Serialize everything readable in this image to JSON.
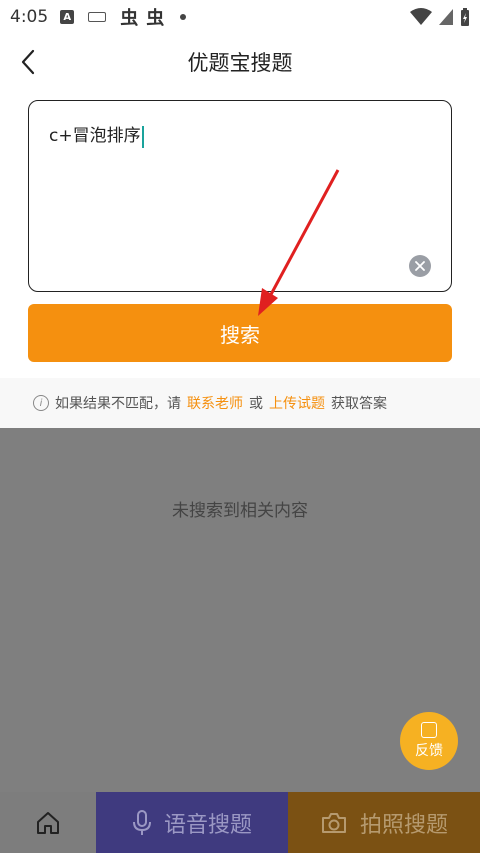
{
  "status": {
    "time": "4:05"
  },
  "header": {
    "title": "优题宝搜题"
  },
  "search": {
    "query": "c+冒泡排序"
  },
  "search_button": {
    "label": "搜索"
  },
  "hint": {
    "prefix": "如果结果不匹配，请",
    "contact_link": "联系老师",
    "or": "或",
    "upload_link": "上传试题",
    "suffix": "获取答案"
  },
  "results": {
    "empty_text": "未搜索到相关内容"
  },
  "feedback": {
    "label": "反馈"
  },
  "tabs": {
    "voice_label": "语音搜题",
    "photo_label": "拍照搜题"
  },
  "colors": {
    "accent": "#f5900f",
    "voice_tab": "#3f3a7f",
    "photo_tab": "#7b5113"
  }
}
